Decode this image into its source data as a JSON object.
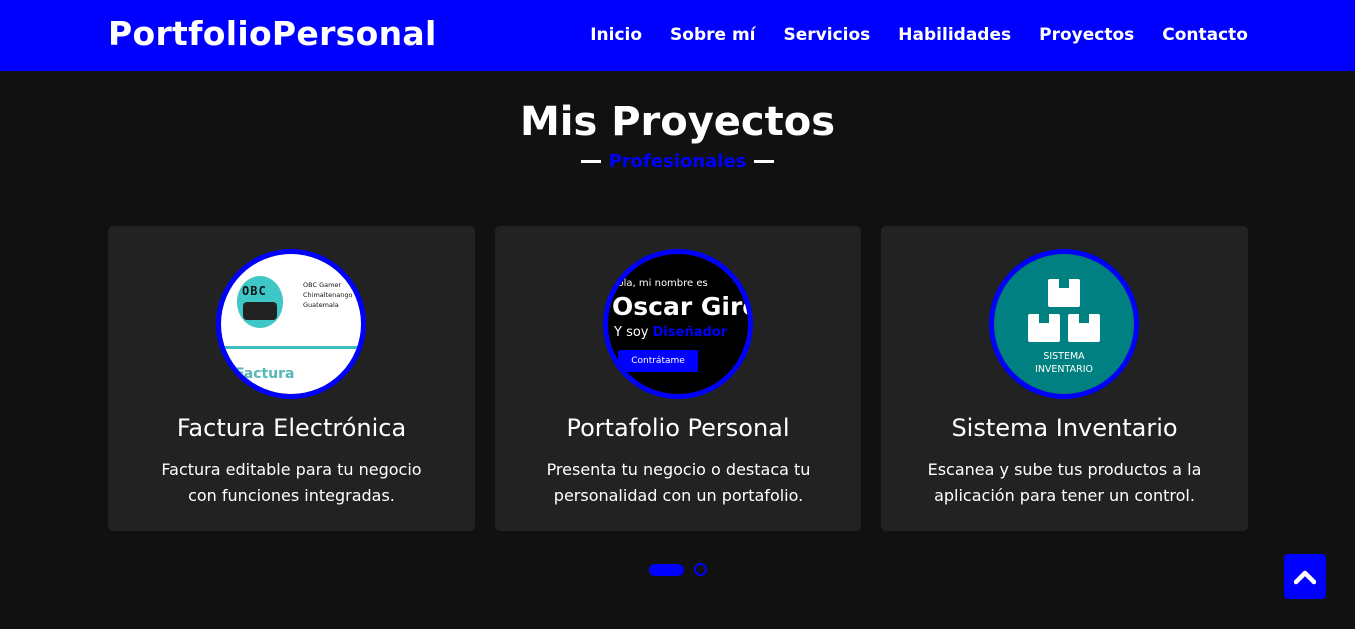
{
  "header": {
    "brand": "PortfolioPersonal",
    "nav": [
      "Inicio",
      "Sobre mí",
      "Servicios",
      "Habilidades",
      "Proyectos",
      "Contacto"
    ]
  },
  "section": {
    "title": "Mis Proyectos",
    "subtitle": "Profesionales"
  },
  "projects": [
    {
      "title": "Factura Electrónica",
      "description": "Factura editable para tu negocio con funciones integradas.",
      "thumb": {
        "logo_text": "OBC",
        "info_lines": [
          "OBC Gamer",
          "Chimaltenango",
          "Guatemala"
        ],
        "heading": "Factura"
      }
    },
    {
      "title": "Portafolio Personal",
      "description": "Presenta tu negocio o destaca tu personalidad con un portafolio.",
      "thumb": {
        "greeting": "Hola, mi nombre es",
        "name": "Oscar Giro",
        "soy": "Y soy",
        "role": "Diseñador",
        "button": "Contrátame"
      }
    },
    {
      "title": "Sistema Inventario",
      "description": "Escanea y sube tus productos a la aplicación para tener un control.",
      "thumb": {
        "line1": "SISTEMA",
        "line2": "INVENTARIO"
      }
    }
  ],
  "colors": {
    "accent": "#0000ff",
    "background": "#111111",
    "card": "#222222"
  },
  "icons": {
    "scroll_top": "chevron-up-icon"
  }
}
